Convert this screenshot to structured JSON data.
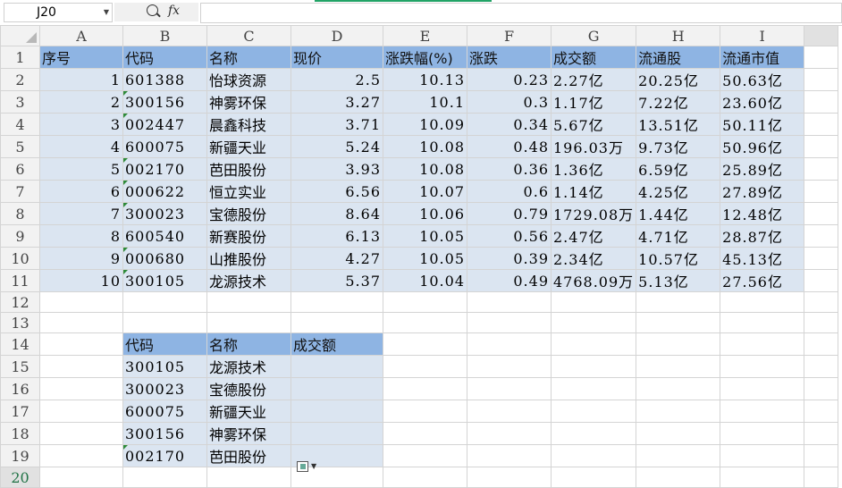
{
  "formula_bar": {
    "cell_ref": "J20",
    "fx_label": "fx",
    "formula": ""
  },
  "columns": [
    "A",
    "B",
    "C",
    "D",
    "E",
    "F",
    "G",
    "H",
    "I"
  ],
  "rows": [
    "1",
    "2",
    "3",
    "4",
    "5",
    "6",
    "7",
    "8",
    "9",
    "10",
    "11",
    "12",
    "13",
    "14",
    "15",
    "16",
    "17",
    "18",
    "19",
    "20"
  ],
  "headers": [
    "序号",
    "代码",
    "名称",
    "现价",
    "涨跌幅(%)",
    "涨跌",
    "成交额",
    "流通股",
    "流通市值"
  ],
  "data_rows": [
    [
      "1",
      "601388",
      "怡球资源",
      "2.5",
      "10.13",
      "0.23",
      "2.27亿",
      "20.25亿",
      "50.63亿"
    ],
    [
      "2",
      "300156",
      "神雾环保",
      "3.27",
      "10.1",
      "0.3",
      "1.17亿",
      "7.22亿",
      "23.60亿"
    ],
    [
      "3",
      "002447",
      "晨鑫科技",
      "3.71",
      "10.09",
      "0.34",
      "5.67亿",
      "13.51亿",
      "50.11亿"
    ],
    [
      "4",
      "600075",
      "新疆天业",
      "5.24",
      "10.08",
      "0.48",
      "196.03万",
      "9.73亿",
      "50.96亿"
    ],
    [
      "5",
      "002170",
      "芭田股份",
      "3.93",
      "10.08",
      "0.36",
      "1.36亿",
      "6.59亿",
      "25.89亿"
    ],
    [
      "6",
      "000622",
      "恒立实业",
      "6.56",
      "10.07",
      "0.6",
      "1.14亿",
      "4.25亿",
      "27.89亿"
    ],
    [
      "7",
      "300023",
      "宝德股份",
      "8.64",
      "10.06",
      "0.79",
      "1729.08万",
      "1.44亿",
      "12.48亿"
    ],
    [
      "8",
      "600540",
      "新赛股份",
      "6.13",
      "10.05",
      "0.56",
      "2.47亿",
      "4.71亿",
      "28.87亿"
    ],
    [
      "9",
      "000680",
      "山推股份",
      "4.27",
      "10.05",
      "0.39",
      "2.34亿",
      "10.57亿",
      "45.13亿"
    ],
    [
      "10",
      "300105",
      "龙源技术",
      "5.37",
      "10.04",
      "0.49",
      "4768.09万",
      "5.13亿",
      "27.56亿"
    ]
  ],
  "lookup_headers": [
    "代码",
    "名称",
    "成交额"
  ],
  "lookup_rows": [
    [
      "300105",
      "龙源技术"
    ],
    [
      "300023",
      "宝德股份"
    ],
    [
      "600075",
      "新疆天业"
    ],
    [
      "300156",
      "神雾环保"
    ],
    [
      "002170",
      "芭田股份"
    ]
  ],
  "colors": {
    "header_fill": "#8eb4e3",
    "data_fill": "#dbe5f1",
    "selection": "#217346"
  }
}
